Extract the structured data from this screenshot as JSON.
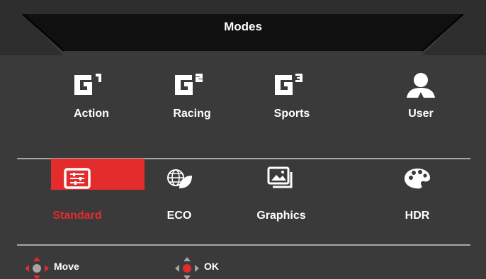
{
  "header": {
    "title": "Modes"
  },
  "modes_top": [
    {
      "label": "Action",
      "icon": "g1-icon"
    },
    {
      "label": "Racing",
      "icon": "g2-icon"
    },
    {
      "label": "Sports",
      "icon": "g3-icon"
    },
    {
      "label": "User",
      "icon": "user-icon"
    }
  ],
  "modes_bottom": [
    {
      "label": "Standard",
      "icon": "sliders-icon",
      "selected": true
    },
    {
      "label": "ECO",
      "icon": "globe-leaf-icon"
    },
    {
      "label": "Graphics",
      "icon": "pictures-icon"
    },
    {
      "label": "HDR",
      "icon": "palette-icon"
    }
  ],
  "footer": {
    "move_label": "Move",
    "ok_label": "OK"
  },
  "colors": {
    "background": "#3a3a3a",
    "title_bar": "#111111",
    "accent_red": "#e32c2c",
    "divider": "#a6a6a6",
    "text": "#ffffff"
  }
}
